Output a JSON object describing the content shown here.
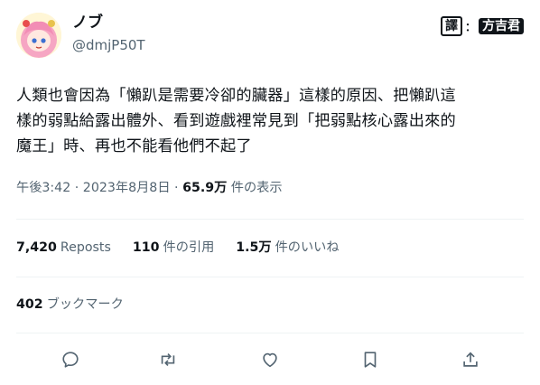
{
  "user": {
    "display_name": "ノブ",
    "handle": "@dmjP50T",
    "avatar": "anime-girl-avatar"
  },
  "translator_badge": {
    "label": "譯",
    "separator": "：",
    "name": "方吉君"
  },
  "tweet": {
    "lines": [
      "人類也會因為「懶趴是需要冷卻的臟器」這樣的原因、把懶趴這",
      "樣的弱點給露出體外、看到遊戲裡常見到「把弱點核心露出來的",
      "魔王」時、再也不能看他們不起了"
    ]
  },
  "meta": {
    "time": "午後3:42",
    "dot": "·",
    "date": "2023年8月8日",
    "views_count": "65.9万",
    "views_label": "件の表示"
  },
  "stats": {
    "reposts_count": "7,420",
    "reposts_label": "Reposts",
    "quotes_count": "110",
    "quotes_label": "件の引用",
    "likes_count": "1.5万",
    "likes_label": "件のいいね"
  },
  "bookmarks": {
    "count": "402",
    "label": "ブックマーク"
  },
  "actions": [
    "reply-icon",
    "repost-icon",
    "like-icon",
    "bookmark-icon",
    "share-icon"
  ],
  "colors": {
    "text": "#0f1419",
    "secondary": "#536471",
    "divider": "#eff3f4"
  }
}
